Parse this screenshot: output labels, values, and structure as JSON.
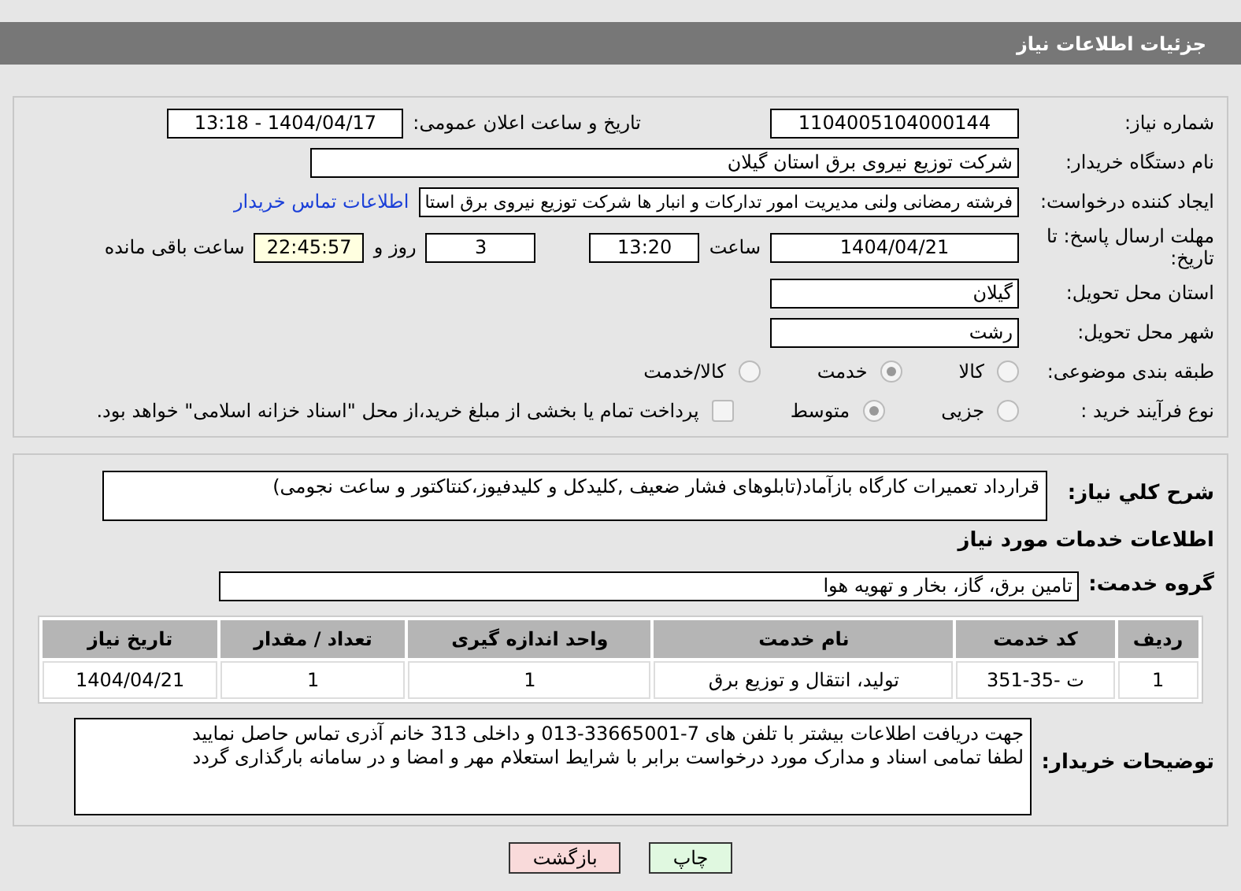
{
  "header": {
    "title": "جزئیات اطلاعات نیاز"
  },
  "info": {
    "need_number": {
      "label": "شماره نیاز:",
      "value": "1104005104000144"
    },
    "announce": {
      "label": "تاریخ و ساعت اعلان عمومی:",
      "value": "1404/04/17 - 13:18"
    },
    "buyer": {
      "label": "نام دستگاه خریدار:",
      "value": "شرکت توزیع نیروی برق استان گیلان"
    },
    "creator": {
      "label": "ایجاد کننده درخواست:",
      "value": "فرشته رمضانی ولنی مدیریت امور تدارکات و انبار ها شرکت توزیع نیروی برق استا",
      "link": "اطلاعات تماس خریدار"
    },
    "deadline": {
      "label": "مهلت ارسال پاسخ: تا تاریخ:",
      "date": "1404/04/21",
      "time_label": "ساعت",
      "time": "13:20",
      "days": "3",
      "days_label": "روز و",
      "remaining": "22:45:57",
      "remaining_label": "ساعت باقی مانده"
    },
    "province": {
      "label": "استان محل تحویل:",
      "value": "گیلان"
    },
    "city": {
      "label": "شهر محل تحویل:",
      "value": "رشت"
    },
    "category": {
      "label": "طبقه بندی موضوعی:",
      "options": [
        {
          "label": "کالا",
          "selected": false
        },
        {
          "label": "خدمت",
          "selected": true
        },
        {
          "label": "کالا/خدمت",
          "selected": false
        }
      ]
    },
    "process": {
      "label": "نوع فرآیند خرید :",
      "options": [
        {
          "label": "جزیی",
          "selected": false
        },
        {
          "label": "متوسط",
          "selected": true
        }
      ],
      "payment": {
        "checked": false,
        "text": "پرداخت تمام یا بخشی از مبلغ خرید،از محل \"اسناد خزانه اسلامی\" خواهد بود."
      }
    }
  },
  "details": {
    "summary": {
      "label": "شرح کلي نیاز:",
      "value": "قرارداد تعمیرات کارگاه بازآماد(تابلوهای فشار ضعیف ,کلیدکل و کلیدفیوز،کنتاکتور و ساعت نجومی)"
    },
    "services_heading": "اطلاعات خدمات مورد نیاز",
    "group": {
      "label": "گروه خدمت:",
      "value": "تامین برق، گاز، بخار و تهویه هوا"
    },
    "table": {
      "columns": [
        "ردیف",
        "کد خدمت",
        "نام خدمت",
        "واحد اندازه گیری",
        "تعداد / مقدار",
        "تاریخ نیاز"
      ],
      "rows": [
        [
          "1",
          "ت -35-351",
          "تولید، انتقال و توزیع برق",
          "1",
          "1",
          "1404/04/21"
        ]
      ]
    },
    "notes": {
      "label": "توضیحات خریدار:",
      "lines": [
        "جهت دریافت اطلاعات بیشتر با تلفن های 7-33665001-013 و داخلی 313 خانم آذری تماس حاصل نمایید",
        "لطفا تمامی اسناد و مدارک مورد درخواست برابر با شرایط استعلام مهر و امضا و در سامانه بارگذاری گردد"
      ]
    }
  },
  "buttons": [
    {
      "label": "چاپ",
      "kind": "print"
    },
    {
      "label": "بازگشت",
      "kind": "back"
    }
  ]
}
